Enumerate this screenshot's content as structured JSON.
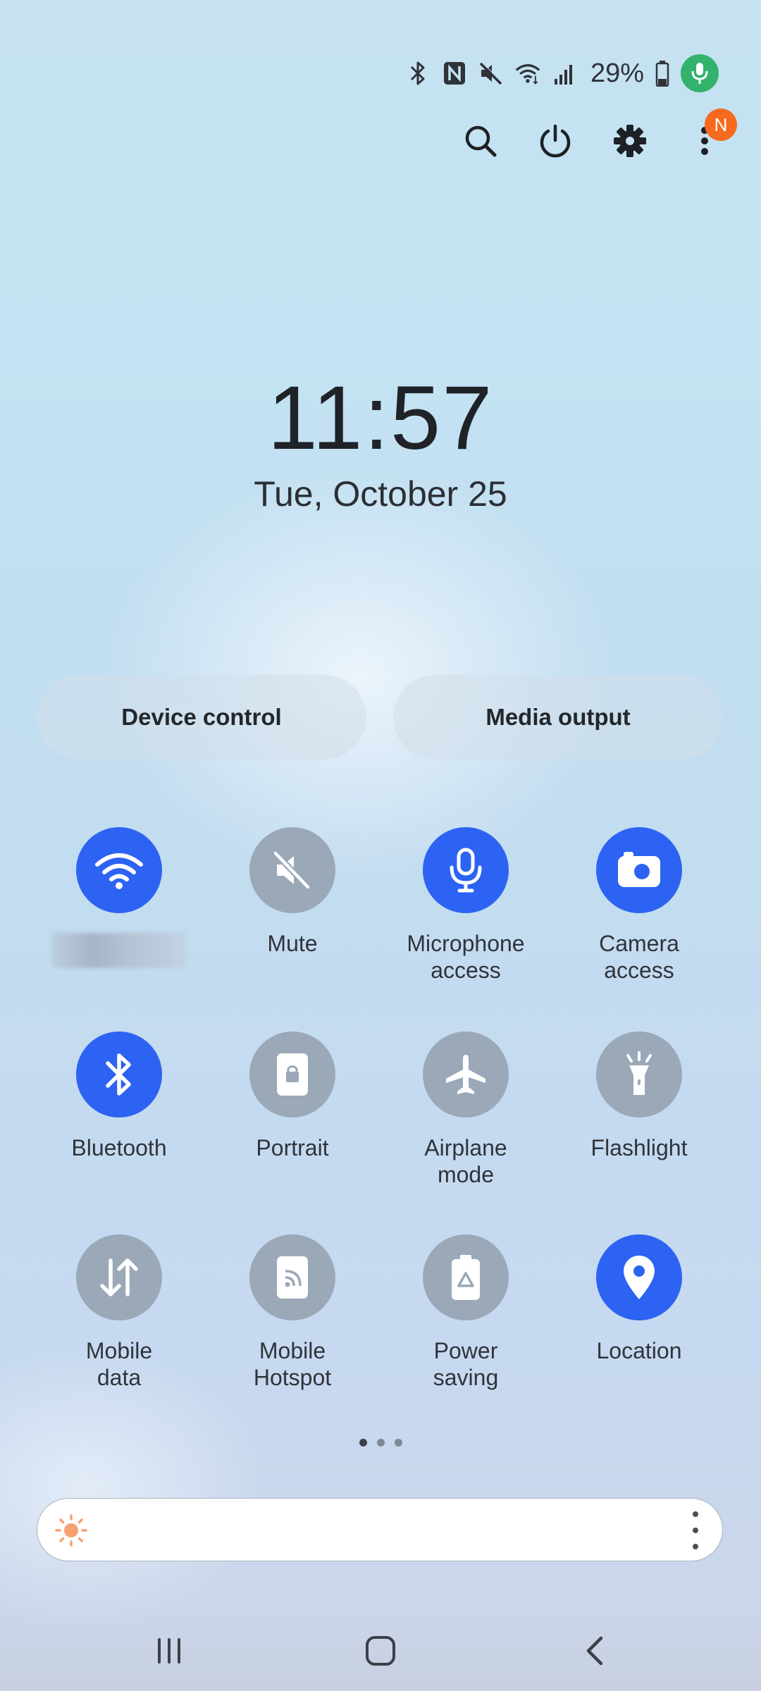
{
  "status_bar": {
    "battery_percent": "29%",
    "icons": [
      "bluetooth-icon",
      "nfc-icon",
      "mute-icon",
      "wifi-icon",
      "signal-icon",
      "battery-icon",
      "mic-active-icon"
    ]
  },
  "top_actions": {
    "icons": [
      "search-icon",
      "power-icon",
      "settings-icon",
      "more-icon"
    ],
    "notification_badge": "N"
  },
  "clock": {
    "time": "11:57",
    "date": "Tue, October 25"
  },
  "pills": {
    "device_control": "Device control",
    "media_output": "Media output"
  },
  "tiles": [
    {
      "id": "wifi",
      "label": "",
      "state": "on",
      "icon": "wifi-icon"
    },
    {
      "id": "mute",
      "label": "Mute",
      "state": "off",
      "icon": "mute-icon"
    },
    {
      "id": "microphone",
      "label": "Microphone\naccess",
      "state": "on",
      "icon": "microphone-icon"
    },
    {
      "id": "camera",
      "label": "Camera\naccess",
      "state": "on",
      "icon": "camera-icon"
    },
    {
      "id": "bluetooth",
      "label": "Bluetooth",
      "state": "on",
      "icon": "bluetooth-icon"
    },
    {
      "id": "portrait",
      "label": "Portrait",
      "state": "off",
      "icon": "portrait-lock-icon"
    },
    {
      "id": "airplane",
      "label": "Airplane\nmode",
      "state": "off",
      "icon": "airplane-icon"
    },
    {
      "id": "flashlight",
      "label": "Flashlight",
      "state": "off",
      "icon": "flashlight-icon"
    },
    {
      "id": "mobile_data",
      "label": "Mobile\ndata",
      "state": "off",
      "icon": "mobile-data-icon"
    },
    {
      "id": "hotspot",
      "label": "Mobile\nHotspot",
      "state": "off",
      "icon": "hotspot-icon"
    },
    {
      "id": "power_saving",
      "label": "Power\nsaving",
      "state": "off",
      "icon": "power-saving-icon"
    },
    {
      "id": "location",
      "label": "Location",
      "state": "on",
      "icon": "location-icon"
    }
  ],
  "page_indicator": {
    "pages": 3,
    "current": 1
  },
  "colors": {
    "tile_on": "#2d63f3",
    "tile_off": "#9aa8b8",
    "badge": "#f56a1e",
    "mic_active": "#33b26c",
    "sun": "#f5a173"
  },
  "navbar": {
    "icons": [
      "recent-apps-icon",
      "home-icon",
      "back-icon"
    ]
  }
}
